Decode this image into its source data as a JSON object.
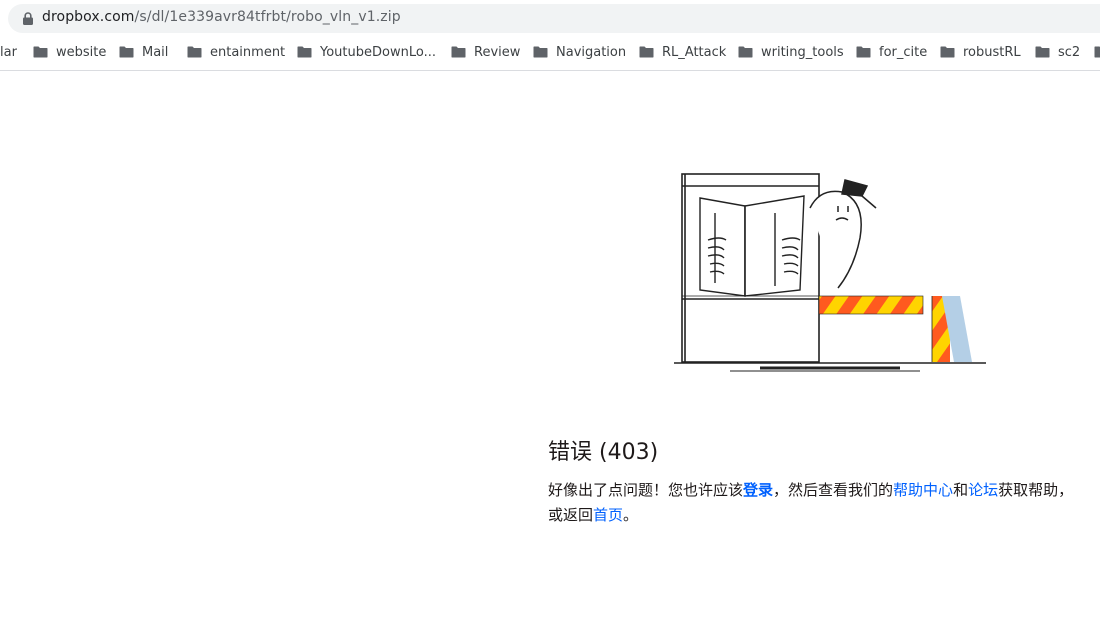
{
  "browser": {
    "url_host": "dropbox.com",
    "url_path": "/s/dl/1e339avr84tfrbt/robo_vln_v1.zip",
    "bookmarks": [
      {
        "label": "lar"
      },
      {
        "label": "website"
      },
      {
        "label": "Mail"
      },
      {
        "label": "entainment"
      },
      {
        "label": "YoutubeDownLo..."
      },
      {
        "label": "Review"
      },
      {
        "label": "Navigation"
      },
      {
        "label": "RL_Attack"
      },
      {
        "label": "writing_tools"
      },
      {
        "label": "for_cite"
      },
      {
        "label": "robustRL"
      },
      {
        "label": "sc2"
      }
    ]
  },
  "error": {
    "title": "错误 (403)",
    "text_1": "好像出了点问题！您也许应该",
    "login_link": "登录",
    "text_2": "，然后查看我们的",
    "help_link": "帮助中心",
    "text_3": "和",
    "forum_link": "论坛",
    "text_4": "获取帮助，或返回",
    "home_link": "首页",
    "text_5": "。"
  },
  "colors": {
    "link": "#0061fe",
    "stripe_orange": "#ff5a1f",
    "stripe_yellow": "#ffd400",
    "barrier_blue": "#b4cfe6"
  }
}
